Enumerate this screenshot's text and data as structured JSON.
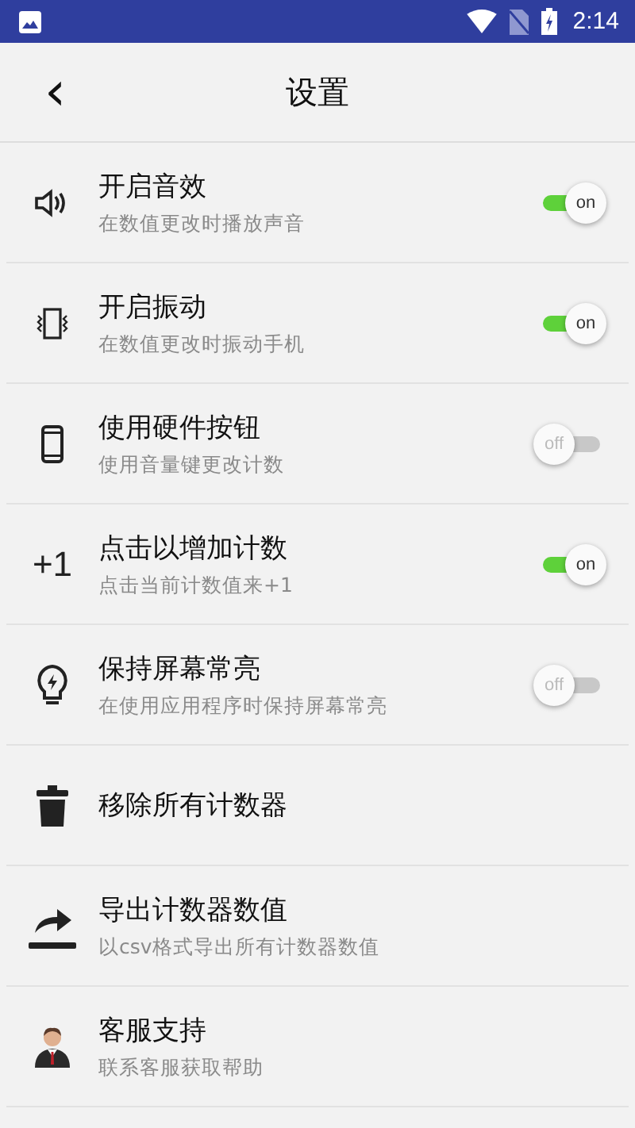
{
  "status_bar": {
    "time": "2:14"
  },
  "header": {
    "back": "‹",
    "title": "设置"
  },
  "settings": [
    {
      "kind": "toggle",
      "title": "开启音效",
      "subtitle": "在数值更改时播放声音",
      "on": true,
      "toggle_label": "on"
    },
    {
      "kind": "toggle",
      "title": "开启振动",
      "subtitle": "在数值更改时振动手机",
      "on": true,
      "toggle_label": "on"
    },
    {
      "kind": "toggle",
      "title": "使用硬件按钮",
      "subtitle": "使用音量键更改计数",
      "on": false,
      "toggle_label": "off"
    },
    {
      "kind": "toggle",
      "icon_text": "+1",
      "title": "点击以增加计数",
      "subtitle": "点击当前计数值来+1",
      "on": true,
      "toggle_label": "on"
    },
    {
      "kind": "toggle",
      "title": "保持屏幕常亮",
      "subtitle": "在使用应用程序时保持屏幕常亮",
      "on": false,
      "toggle_label": "off"
    },
    {
      "kind": "action",
      "title": "移除所有计数器"
    },
    {
      "kind": "action",
      "title": "导出计数器数值",
      "subtitle": "以csv格式导出所有计数器数值"
    },
    {
      "kind": "action",
      "title": "客服支持",
      "subtitle": "联系客服获取帮助"
    }
  ]
}
